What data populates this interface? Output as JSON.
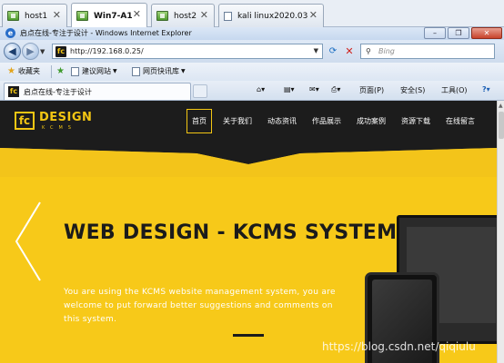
{
  "vm_tabs": [
    {
      "label": "host1",
      "active": false
    },
    {
      "label": "Win7-A1",
      "active": true
    },
    {
      "label": "host2",
      "active": false
    },
    {
      "label": "kali linux2020.03",
      "active": false
    }
  ],
  "browser": {
    "window_title": "启点在线-专注于设计 - Windows Internet Explorer",
    "address": "http://192.168.0.25/",
    "search_placeholder": "Bing",
    "favorites": {
      "label": "收藏夹",
      "items": [
        "建议网站",
        "网页快讯库"
      ]
    },
    "tab_title": "启点在线-专注于设计",
    "commands": {
      "page": "页面(P)",
      "safety": "安全(S)",
      "tools": "工具(O)"
    }
  },
  "site": {
    "logo_main": "DESIGN",
    "logo_sub": "KCMS",
    "logo_mark": "fc",
    "nav": [
      "首页",
      "关于我们",
      "动态资讯",
      "作品展示",
      "成功案例",
      "资源下载",
      "在线留言"
    ],
    "active_nav": "首页",
    "hero_title": "WEB DESIGN - KCMS SYSTEM",
    "hero_text": "You are using the KCMS website management system, you are welcome to put forward better suggestions and comments on this system."
  },
  "watermark": "https://blog.csdn.net/qiqiulu",
  "colors": {
    "brand_yellow": "#f3c613",
    "hero_bg": "#f7c919",
    "nav_bg": "#1c1c1c",
    "ie_chrome": "#d4e0ef"
  }
}
